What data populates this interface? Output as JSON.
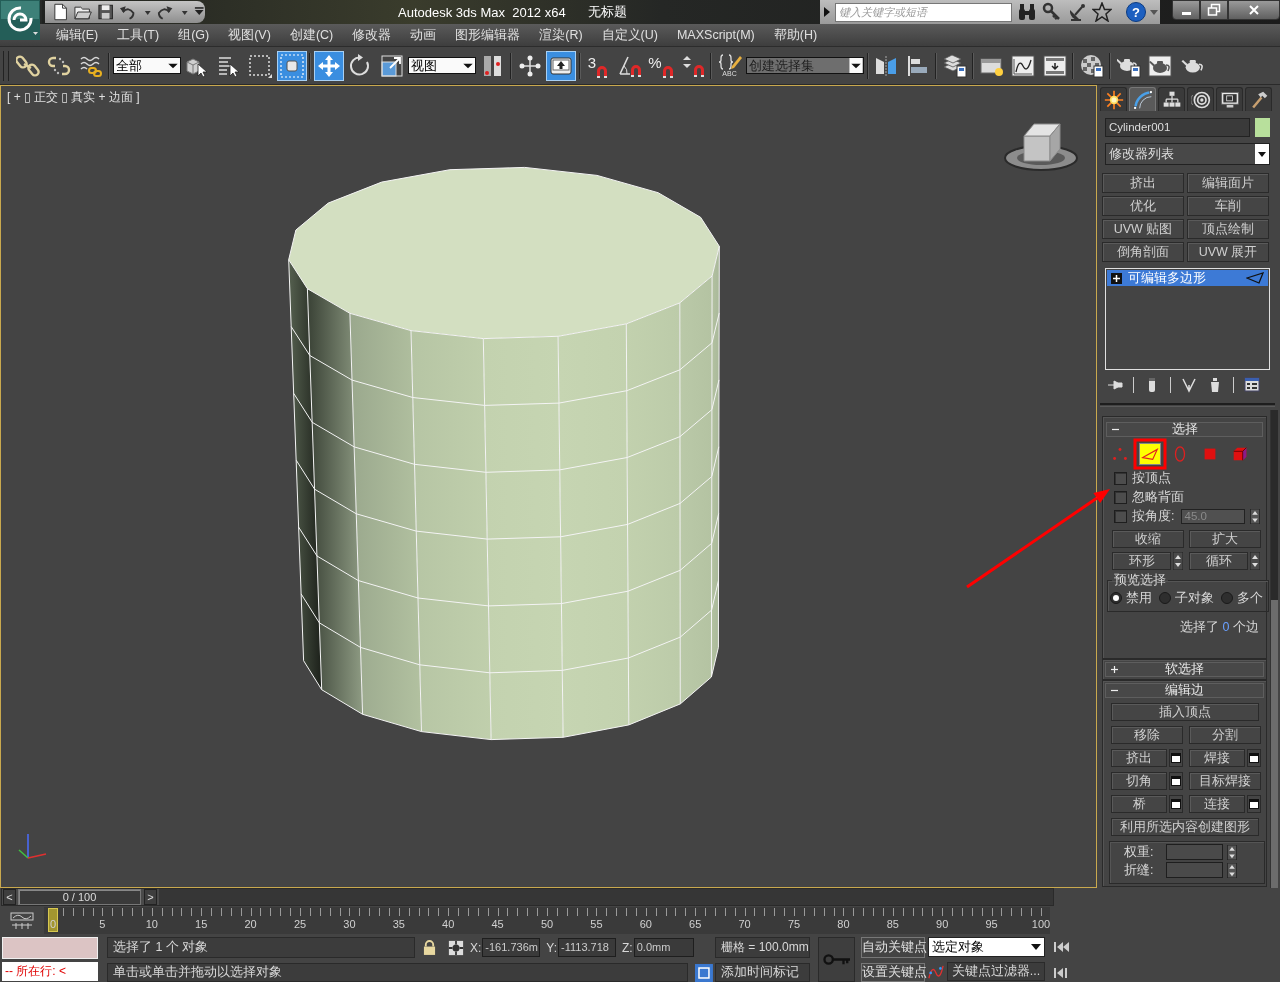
{
  "title_bar": {
    "app_title": "Autodesk 3ds Max  2012 x64",
    "document_title": "无标题",
    "search": {
      "placeholder": "键入关键字或短语"
    },
    "help": "?"
  },
  "menu_bar": [
    "编辑(E)",
    "工具(T)",
    "组(G)",
    "视图(V)",
    "创建(C)",
    "修改器",
    "动画",
    "图形编辑器",
    "渲染(R)",
    "自定义(U)",
    "MAXScript(M)",
    "帮助(H)"
  ],
  "main_toolbar": {
    "items": [
      {
        "kind": "tool",
        "selected": false
      },
      {
        "kind": "tool",
        "selected": false
      },
      {
        "kind": "tool",
        "selected": false
      },
      {
        "kind": "dropdown",
        "value": "全部"
      },
      {
        "kind": "tool",
        "selected": false
      },
      {
        "kind": "tool",
        "selected": false
      },
      {
        "kind": "tool",
        "selected": false
      },
      {
        "kind": "tool",
        "selected": true
      },
      {
        "kind": "tool",
        "selected": true
      },
      {
        "kind": "tool",
        "selected": false
      },
      {
        "kind": "tool",
        "selected": false
      },
      {
        "kind": "dropdown",
        "value": "视图"
      },
      {
        "kind": "tool",
        "selected": false
      },
      {
        "kind": "tool",
        "selected": false
      },
      {
        "kind": "tool",
        "selected": true
      },
      {
        "kind": "tool",
        "selected": false,
        "label": "3"
      },
      {
        "kind": "tool",
        "selected": false
      },
      {
        "kind": "tool",
        "selected": false,
        "label": "%"
      },
      {
        "kind": "tool",
        "selected": false
      },
      {
        "kind": "tool",
        "selected": false,
        "label": "ABC"
      },
      {
        "kind": "dropdown",
        "placeholder": "创建选择集"
      },
      {
        "kind": "tool",
        "selected": false
      },
      {
        "kind": "tool",
        "selected": false
      },
      {
        "kind": "tool",
        "selected": false
      },
      {
        "kind": "tool",
        "selected": false
      },
      {
        "kind": "tool",
        "selected": false
      },
      {
        "kind": "tool",
        "selected": false
      },
      {
        "kind": "tool",
        "selected": false
      },
      {
        "kind": "tool",
        "selected": false
      },
      {
        "kind": "tool",
        "selected": false
      },
      {
        "kind": "tool",
        "selected": false
      }
    ]
  },
  "viewport": {
    "label": "[ + ▯ 正交 ▯ 真实 + 边面 ]"
  },
  "command_panel": {
    "tabs": [
      {
        "selected": false
      },
      {
        "selected": true
      },
      {
        "selected": false
      },
      {
        "selected": false
      },
      {
        "selected": false
      },
      {
        "selected": false
      }
    ],
    "object": {
      "name": "Cylinder001",
      "color": "#b8e09c"
    },
    "modifier_list": "修改器列表",
    "modifier_buttons": [
      "挤出",
      "编辑面片",
      "优化",
      "车削",
      "UVW 贴图",
      "顶点绘制",
      "倒角剖面",
      "UVW 展开"
    ],
    "modifier_stack": [
      {
        "label": "可编辑多边形",
        "selected": true
      }
    ],
    "selection_rollout": {
      "title": "选择",
      "expanded": true,
      "levels": [
        {
          "selected": false,
          "highlighted": false
        },
        {
          "selected": true,
          "highlighted": true
        },
        {
          "selected": false,
          "highlighted": false
        },
        {
          "selected": false,
          "highlighted": false
        },
        {
          "selected": false,
          "highlighted": false
        }
      ],
      "checkboxes": [
        {
          "label": "按顶点",
          "checked": false
        },
        {
          "label": "忽略背面",
          "checked": false
        }
      ],
      "by_angle": {
        "label": "按角度:",
        "checked": false,
        "value": "45.0",
        "disabled": true
      },
      "buttons": [
        {
          "label": "收缩",
          "kind": "button"
        },
        {
          "label": "扩大",
          "kind": "button"
        },
        {
          "label": "环形",
          "kind": "spinner"
        },
        {
          "label": "循环",
          "kind": "spinner"
        }
      ],
      "preview": {
        "title": "预览选择",
        "options": [
          {
            "label": "禁用",
            "selected": true
          },
          {
            "label": "子对象",
            "selected": false
          },
          {
            "label": "多个",
            "selected": false
          }
        ]
      },
      "summary": {
        "prefix": "选择了",
        "count": "0",
        "suffix": "个边"
      }
    },
    "soft_selection_rollout": {
      "title": "软选择",
      "expanded": false
    },
    "edit_edges_rollout": {
      "title": "编辑边",
      "expanded": true,
      "buttons": [
        {
          "label": "插入顶点",
          "kind": "wide"
        },
        {
          "label": "移除",
          "kind": "plain"
        },
        {
          "label": "分割",
          "kind": "plain"
        },
        {
          "label": "挤出",
          "kind": "settings"
        },
        {
          "label": "焊接",
          "kind": "settings"
        },
        {
          "label": "切角",
          "kind": "settings"
        },
        {
          "label": "目标焊接",
          "kind": "plain"
        },
        {
          "label": "桥",
          "kind": "settings"
        },
        {
          "label": "连接",
          "kind": "settings"
        },
        {
          "label": "利用所选内容创建图形",
          "kind": "wide"
        }
      ],
      "fields": [
        {
          "label": "权重:"
        },
        {
          "label": "折缝:"
        }
      ]
    }
  },
  "time_slider": {
    "prev": "<",
    "position": "0 / 100",
    "next": ">",
    "level": 0
  },
  "track_bar": {
    "frames": [
      "0",
      "5",
      "10",
      "15",
      "20",
      "25",
      "30",
      "35",
      "40",
      "45",
      "50",
      "55",
      "60",
      "65",
      "70",
      "75",
      "80",
      "85",
      "90",
      "95",
      "100"
    ]
  },
  "status_bar": {
    "listener_output": "-- 所在行: <",
    "selection_status": "选择了 1 个 对象",
    "prompt": "单击或单击并拖动以选择对象",
    "coordinates": [
      {
        "label": "X:",
        "value": "-161.736m"
      },
      {
        "label": "Y:",
        "value": "-1113.718"
      },
      {
        "label": "Z:",
        "value": "0.0mm"
      }
    ],
    "grid": "栅格 = 100.0mm",
    "time_tag": "添加时间标记",
    "auto_key": "自动关键点",
    "set_key": "设置关键点",
    "key_mode": "选定对象",
    "key_filters": "关键点过滤器..."
  }
}
